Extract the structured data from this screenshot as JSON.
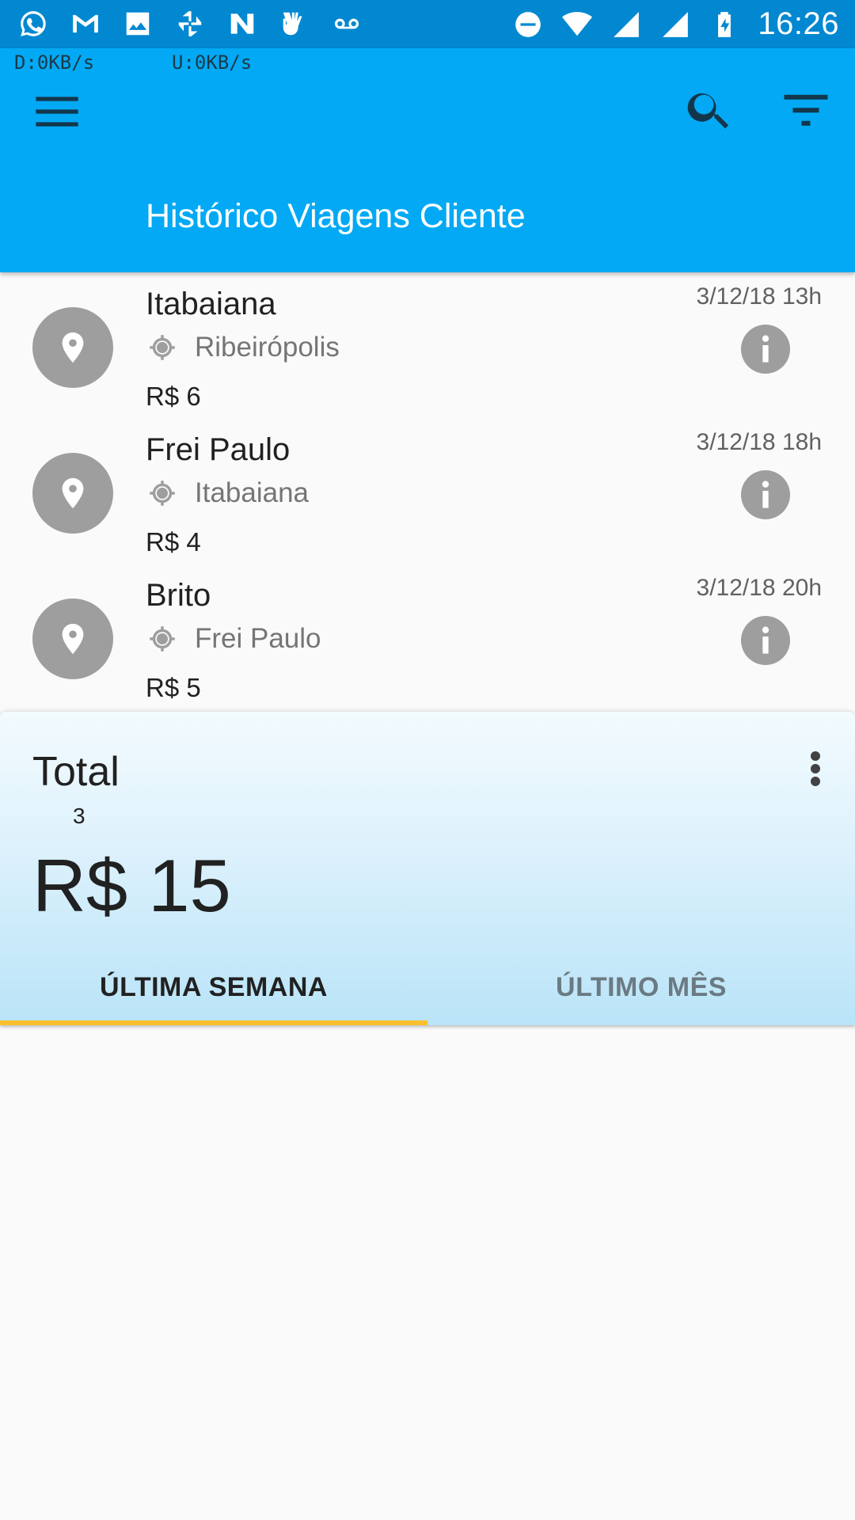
{
  "status_bar": {
    "time": "16:26",
    "notification_icons": [
      "whatsapp-icon",
      "gmail-icon",
      "image-icon",
      "pinwheel-icon",
      "n-app-icon",
      "hand-icon",
      "voicemail-icon"
    ],
    "system_icons": [
      "do-not-disturb-icon",
      "wifi-icon",
      "signal-icon",
      "signal-icon",
      "battery-charging-icon"
    ]
  },
  "app_bar": {
    "download_speed": "D:0KB/s",
    "upload_speed": "U:0KB/s",
    "title": "Histórico Viagens Cliente",
    "color": "#03a9f4"
  },
  "trips": [
    {
      "destination": "Itabaiana",
      "origin": "Ribeirópolis",
      "price": "R$ 6",
      "date": "3/12/18 13h"
    },
    {
      "destination": "Frei Paulo",
      "origin": "Itabaiana",
      "price": "R$ 4",
      "date": "3/12/18 18h"
    },
    {
      "destination": "Brito",
      "origin": "Frei Paulo",
      "price": "R$ 5",
      "date": "3/12/18 20h"
    }
  ],
  "summary": {
    "label": "Total",
    "count": "3",
    "total": "R$ 15",
    "tabs": [
      {
        "label": "ÚLTIMA SEMANA",
        "selected": true
      },
      {
        "label": "ÚLTIMO MÊS",
        "selected": false
      }
    ],
    "indicator_color": "#fbc02d"
  }
}
